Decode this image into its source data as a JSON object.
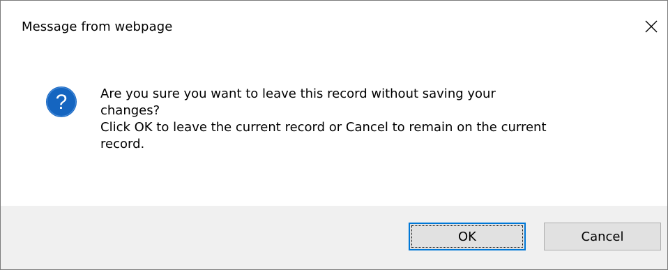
{
  "dialog": {
    "title": "Message from webpage",
    "close_icon": "close-icon",
    "question_icon": "question-icon",
    "message_lines": [
      "Are you sure you want to leave this record without saving your",
      "changes?",
      "Click OK to leave the current record or Cancel to remain on the current",
      "record."
    ],
    "ok_label": "OK",
    "cancel_label": "Cancel"
  },
  "colors": {
    "question_icon_fill": "#1565c0",
    "focus_border": "#0078d7",
    "footer_bg": "#f0f0f0",
    "button_bg": "#e1e1e1"
  }
}
